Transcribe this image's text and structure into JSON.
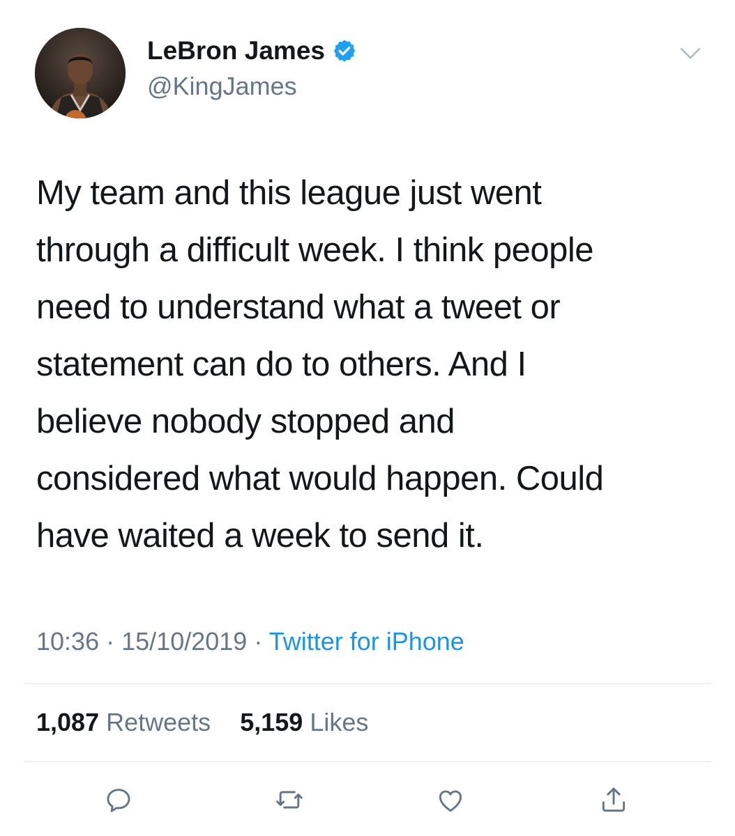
{
  "author": {
    "display_name": "LeBron James",
    "handle": "@KingJames",
    "verified": true
  },
  "tweet": {
    "lines": [
      "My team and this league just went",
      "through a difficult week.  I think people",
      "need to understand what a tweet or",
      "statement can do to others.  And I",
      "believe nobody stopped and",
      "considered what would happen.  Could",
      "have waited a week to send it."
    ],
    "time": "10:36",
    "separator": "·",
    "date": "15/10/2019",
    "source": "Twitter for iPhone"
  },
  "stats": {
    "retweets_count": "1,087",
    "retweets_label": "Retweets",
    "likes_count": "5,159",
    "likes_label": "Likes"
  },
  "icons": {
    "verified": "verified-badge-icon",
    "menu": "chevron-down-icon",
    "reply": "reply-icon",
    "retweet": "retweet-icon",
    "like": "heart-icon",
    "share": "share-icon"
  },
  "colors": {
    "text": "#14171a",
    "muted": "#657786",
    "link": "#1b95e0",
    "verified": "#1da1f2",
    "divider": "#e1e8ed"
  }
}
